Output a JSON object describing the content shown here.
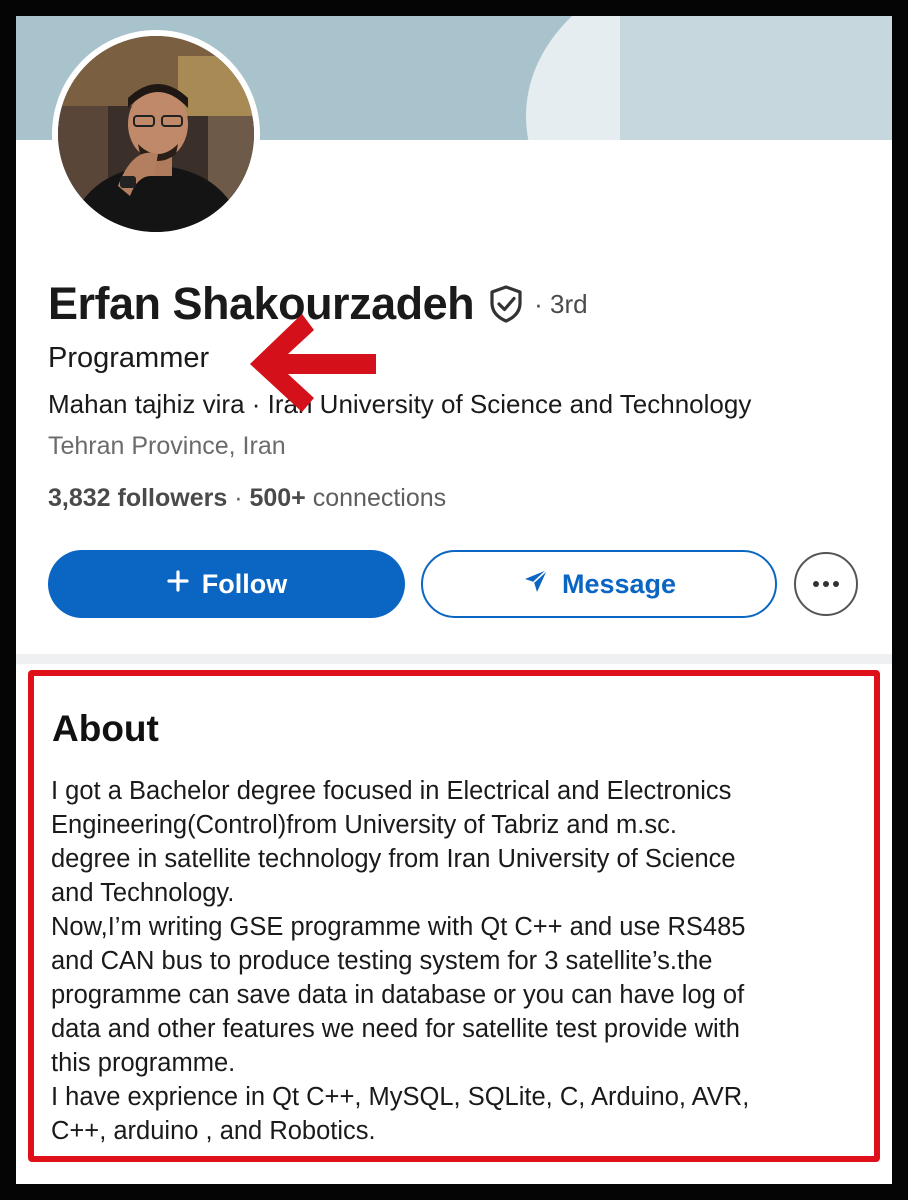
{
  "profile": {
    "name": "Erfan Shakourzadeh",
    "verified_icon": "shield-check-icon",
    "degree": "· 3rd",
    "headline": "Programmer",
    "subtitle": "Mahan tajhiz vira · Iran University of Science and Technology",
    "location": "Tehran Province, Iran",
    "followers_count": "3,832 followers",
    "separator": " · ",
    "connections_count": "500+",
    "connections_label": " connections"
  },
  "actions": {
    "follow_label": "Follow",
    "follow_icon": "plus-icon",
    "message_label": "Message",
    "message_icon": "send-icon",
    "more_icon": "more-horizontal-icon"
  },
  "about": {
    "title": "About",
    "lines": [
      "I got a Bachelor degree focused in Electrical and Electronics",
      "Engineering(Control)from University of Tabriz and m.sc.",
      "degree in satellite technology from  Iran University of Science",
      "and Technology.",
      "Now,I’m writing GSE programme with Qt C++ and use RS485",
      "and CAN bus to produce testing system for 3 satellite’s.the",
      "programme can save data in database or you can have log of",
      "data and other features we need for satellite test provide with",
      "this programme.",
      "I have exprience in Qt C++, MySQL, SQLite, C, Arduino, AVR,",
      "C++, arduino , and Robotics."
    ]
  },
  "colors": {
    "brand_blue": "#0a66c2",
    "highlight_red": "#e0101a",
    "banner": "#a9c3cc"
  }
}
